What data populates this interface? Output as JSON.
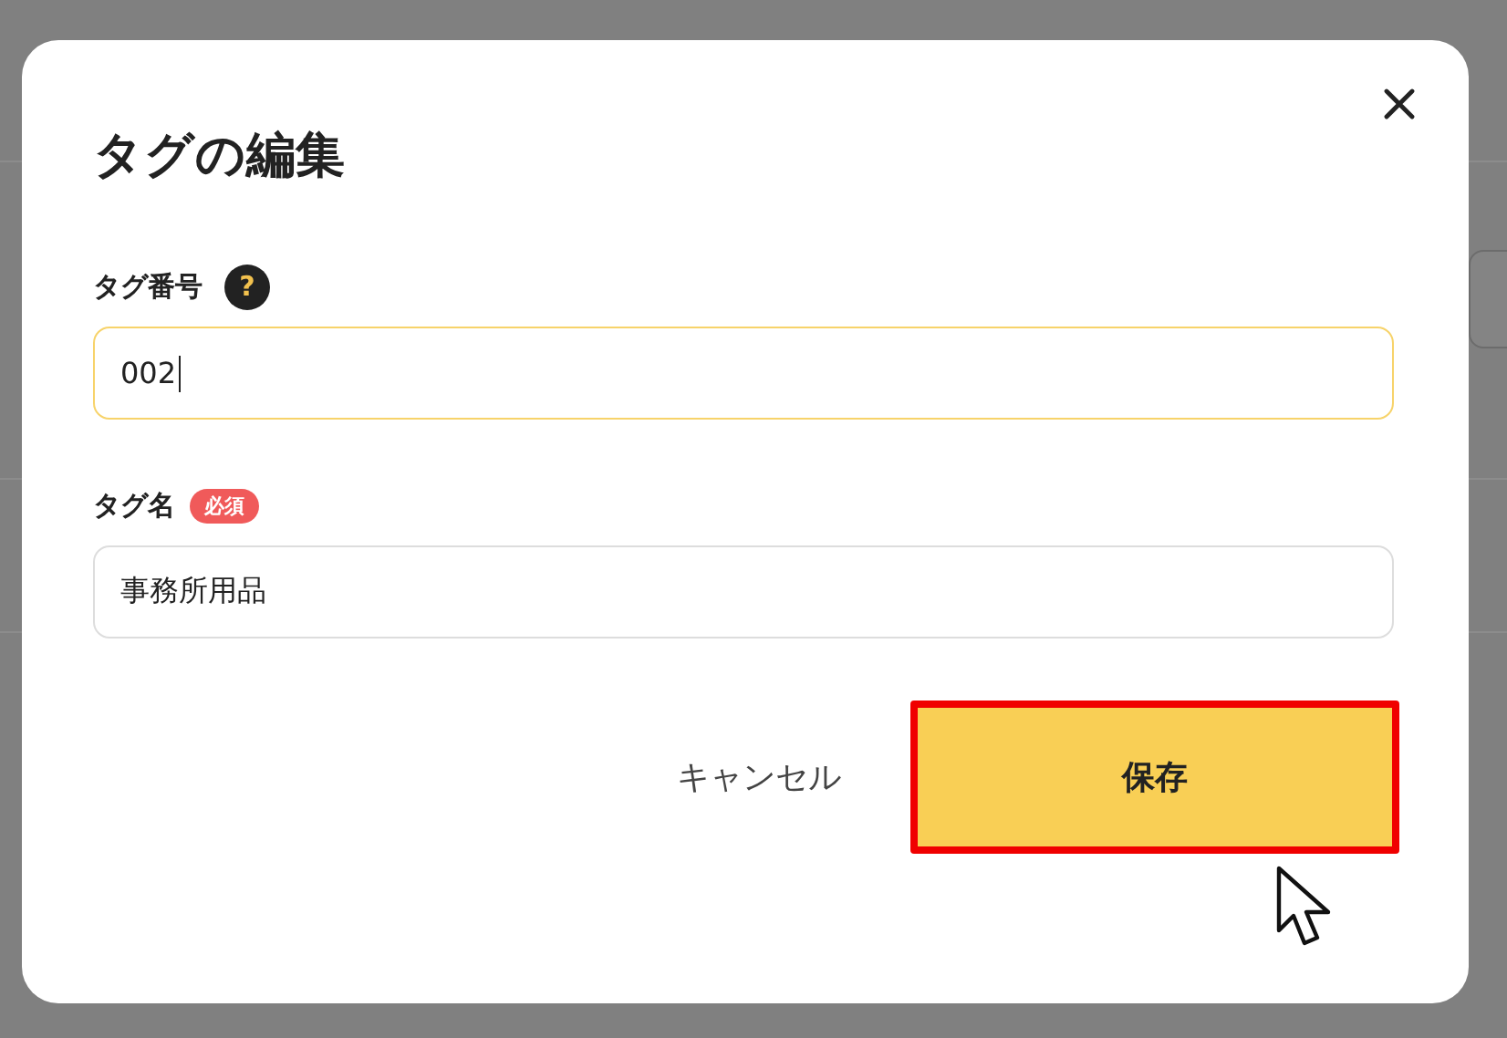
{
  "dialog": {
    "title": "タグの編集",
    "fields": [
      {
        "label": "タグ番号",
        "help": "?",
        "value": "002",
        "focused": true
      },
      {
        "label": "タグ名",
        "required_badge": "必須",
        "value": "事務所用品",
        "focused": false
      }
    ],
    "buttons": [
      {
        "kind": "text",
        "label": "キャンセル",
        "highlighted": false
      },
      {
        "kind": "primary",
        "label": "保存",
        "highlighted": true
      }
    ]
  }
}
